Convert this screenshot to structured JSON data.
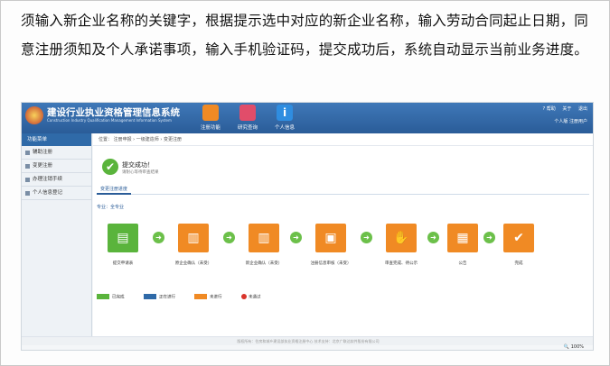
{
  "intro_text": "须输入新企业名称的关键字，根据提示选中对应的新企业名称，输入劳动合同起止日期，同意注册须知及个人承诺事项，输入手机验证码，提交成功后，系统自动显示当前业务进度。",
  "header": {
    "title": "建设行业执业资格管理信息系统",
    "subtitle": "Construction Industry Qualification Management Information System",
    "nav": [
      {
        "label": "注册功能",
        "color": "#f08a24"
      },
      {
        "label": "研究查询",
        "color": "#e14d6a"
      },
      {
        "label": "个人信息",
        "color": "#2f8de0"
      }
    ],
    "top_links": [
      "? 帮助",
      "关于",
      "退出"
    ],
    "user": "个人版  注册用户"
  },
  "sidebar": {
    "head": "功能菜单",
    "items": [
      "辅助注册",
      "变更注册",
      "办理注销手续",
      "个人信息登记"
    ]
  },
  "breadcrumb": "位置：  注册申报  ›  一级建造师  ›  变更注册",
  "result": {
    "title": "提交成功！",
    "subtitle": "请耐心等待审查结果"
  },
  "tab": "变更注册进度",
  "business_line": "专业：全专业",
  "steps": [
    {
      "caption": "提交申请表",
      "color": "#5ab43c",
      "icon": "document-icon"
    },
    {
      "caption": "原企业确认（未受）",
      "color": "#f08a24",
      "icon": "folder-icon"
    },
    {
      "caption": "新企业确认（未受）",
      "color": "#f08a24",
      "icon": "folder-icon"
    },
    {
      "caption": "注册信息审核（未受）",
      "color": "#f08a24",
      "icon": "monitor-icon"
    },
    {
      "caption": "审查完成、待公示",
      "color": "#f08a24",
      "icon": "hands-icon"
    },
    {
      "caption": "公告",
      "color": "#f08a24",
      "icon": "notice-icon"
    },
    {
      "caption": "完成",
      "color": "#f08a24",
      "icon": "check-icon"
    }
  ],
  "legend": [
    {
      "label": "已完成",
      "color": "#5ab43c"
    },
    {
      "label": "正在进行",
      "color": "#2f6aa8"
    },
    {
      "label": "未进行",
      "color": "#f08a24"
    },
    {
      "label": "未通过",
      "color": "#d9342b"
    }
  ],
  "footer": "版权所有：住房和城乡建设部执业资格注册中心   技术支持：北京广联达软件股份有限公司",
  "zoom": "100%"
}
